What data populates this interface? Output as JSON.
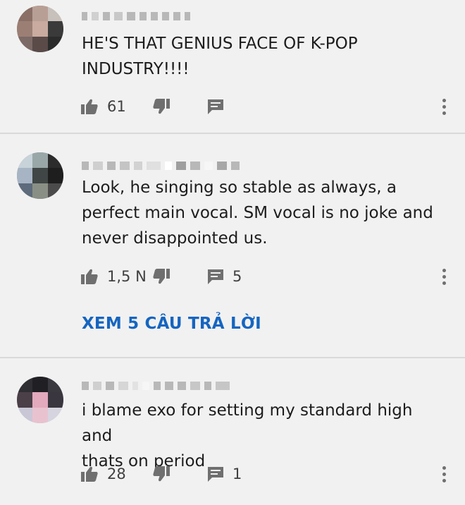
{
  "comments": [
    {
      "author": "",
      "text": "HE'S THAT GENIUS FACE OF K-POP\nINDUSTRY!!!!",
      "likes": "61",
      "reply_count": "",
      "view_replies": ""
    },
    {
      "author": "",
      "text": "Look, he singing so stable as always, a\nperfect main vocal. SM vocal is no joke and\nnever disappointed us.",
      "likes": "1,5 N",
      "reply_count": "5",
      "view_replies": "XEM 5 CÂU TRẢ LỜI"
    },
    {
      "author": "",
      "text": "i blame exo for setting my standard high and\nthats on period",
      "likes": "28",
      "reply_count": "1",
      "view_replies": ""
    }
  ],
  "icons": {
    "like": "thumbs-up-icon",
    "dislike": "thumbs-down-icon",
    "reply": "reply-comment-icon",
    "more": "more-vertical-icon"
  },
  "colors": {
    "background": "#f1f1f1",
    "link": "#1565c0",
    "icon": "#6f6f6f",
    "divider": "#d9d9d9"
  }
}
